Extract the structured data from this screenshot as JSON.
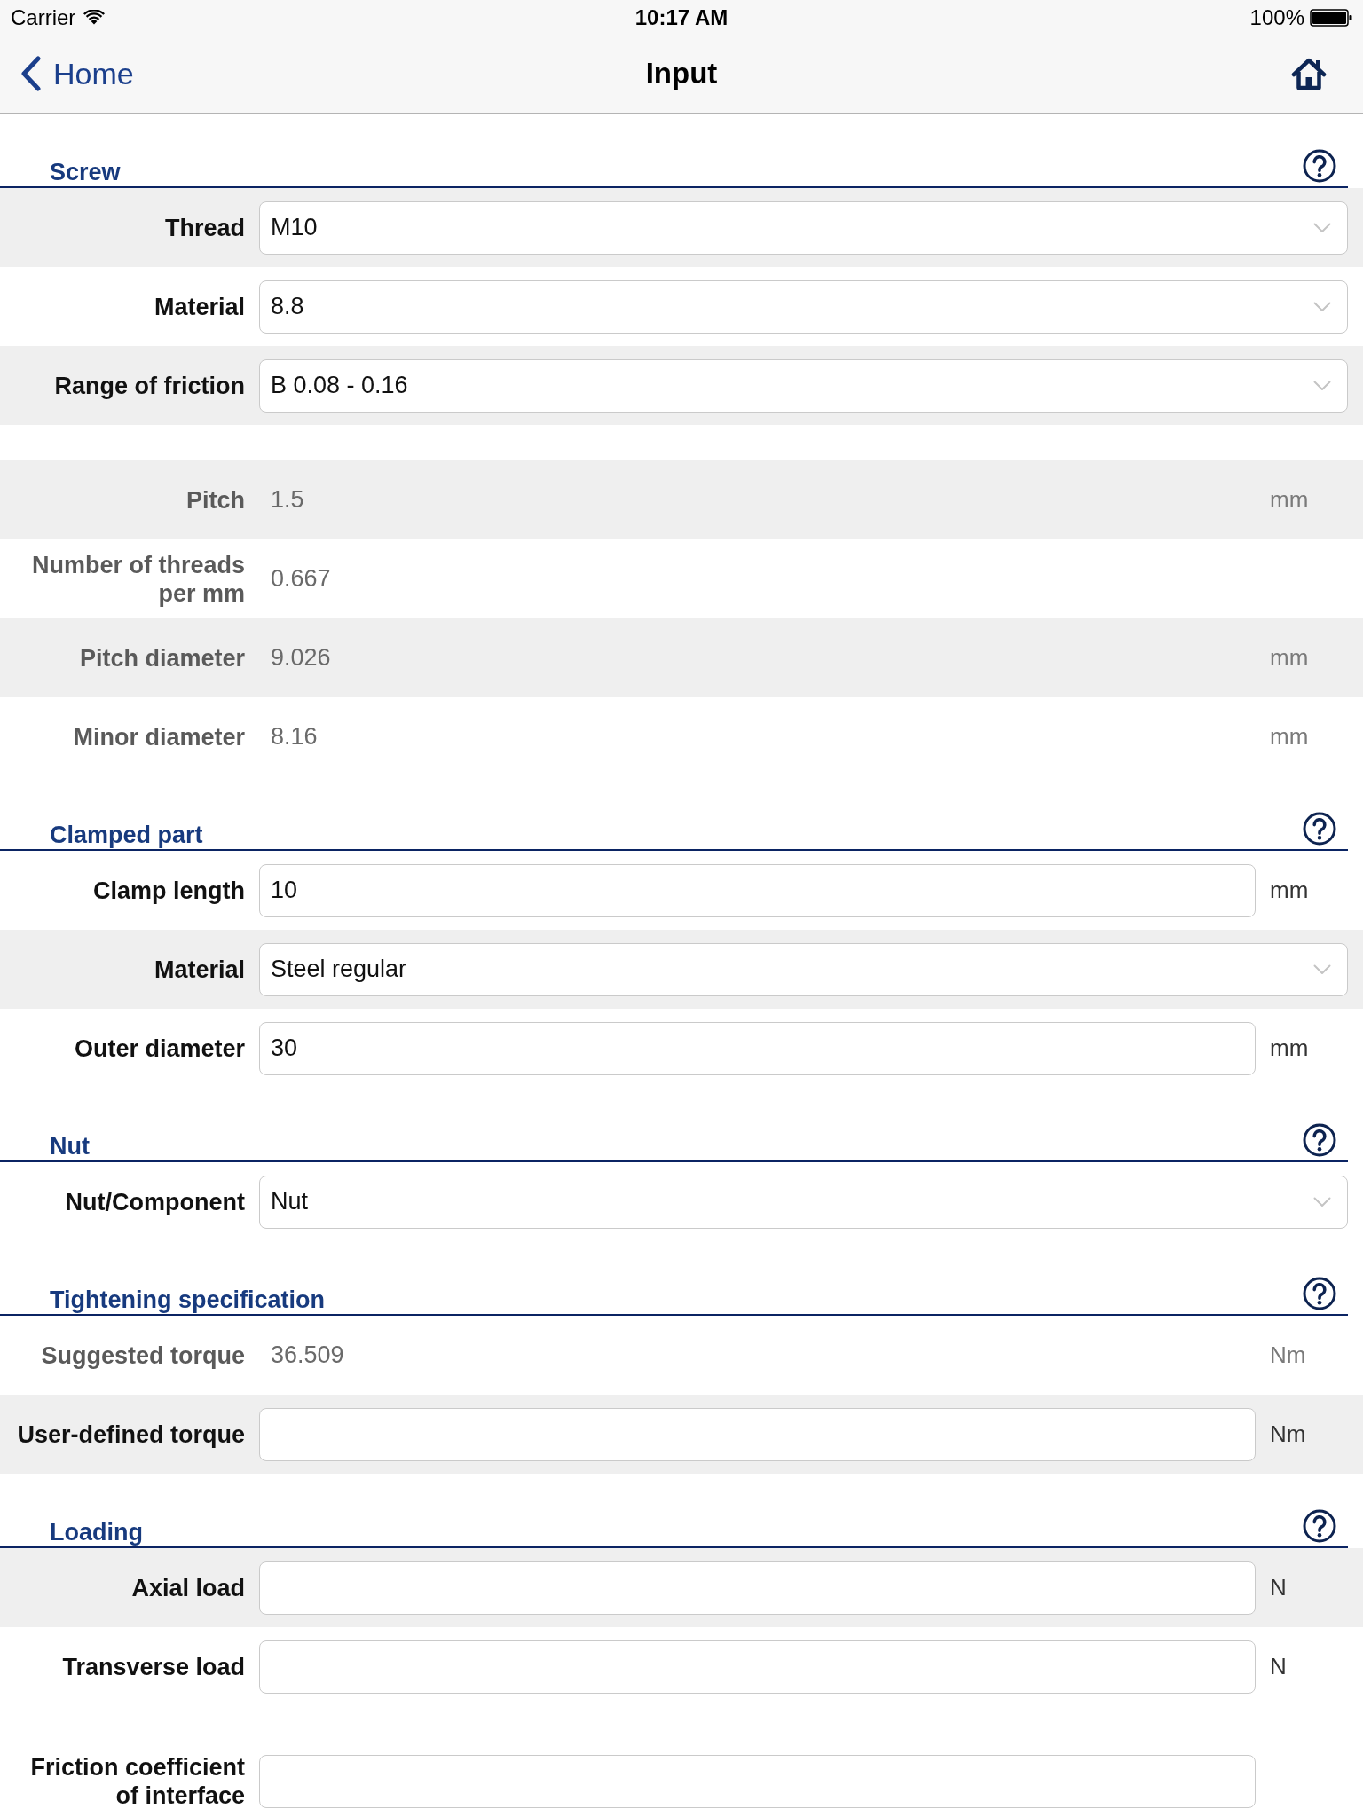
{
  "status_bar": {
    "carrier": "Carrier",
    "time": "10:17 AM",
    "battery": "100%"
  },
  "nav_bar": {
    "back": "Home",
    "title": "Input"
  },
  "sections": [
    {
      "title": "Screw",
      "groups": [
        {
          "rows": [
            {
              "kind": "select",
              "label": "Thread",
              "value": "M10",
              "shaded": true
            },
            {
              "kind": "select",
              "label": "Material",
              "value": "8.8",
              "shaded": false
            },
            {
              "kind": "select",
              "label": "Range of friction",
              "value": "B 0.08 - 0.16",
              "shaded": true
            }
          ]
        },
        {
          "rows": [
            {
              "kind": "computed",
              "label": "Pitch",
              "value": "1.5",
              "unit": "mm",
              "shaded": true
            },
            {
              "kind": "computed",
              "label": "Number of threads per mm",
              "value": "0.667",
              "shaded": false
            },
            {
              "kind": "computed",
              "label": "Pitch diameter",
              "value": "9.026",
              "unit": "mm",
              "shaded": true
            },
            {
              "kind": "computed",
              "label": "Minor diameter",
              "value": "8.16",
              "unit": "mm",
              "shaded": false
            }
          ]
        }
      ]
    },
    {
      "title": "Clamped part",
      "groups": [
        {
          "rows": [
            {
              "kind": "input",
              "label": "Clamp length",
              "value": "10",
              "unit": "mm",
              "shaded": false
            },
            {
              "kind": "select",
              "label": "Material",
              "value": "Steel regular",
              "shaded": true
            },
            {
              "kind": "input",
              "label": "Outer diameter",
              "value": "30",
              "unit": "mm",
              "shaded": false
            }
          ]
        }
      ]
    },
    {
      "title": "Nut",
      "groups": [
        {
          "rows": [
            {
              "kind": "select",
              "label": "Nut/Component",
              "value": "Nut",
              "shaded": false
            }
          ]
        }
      ]
    },
    {
      "title": "Tightening specification",
      "groups": [
        {
          "rows": [
            {
              "kind": "computed",
              "label": "Suggested torque",
              "value": "36.509",
              "unit": "Nm",
              "shaded": false
            },
            {
              "kind": "input",
              "label": "User-defined torque",
              "unit": "Nm",
              "shaded": true
            }
          ]
        }
      ]
    },
    {
      "title": "Loading",
      "groups": [
        {
          "rows": [
            {
              "kind": "input",
              "label": "Axial load",
              "unit": "N",
              "shaded": true
            },
            {
              "kind": "input",
              "label": "Transverse load",
              "unit": "N",
              "shaded": false
            }
          ]
        },
        {
          "rows": [
            {
              "kind": "input",
              "label": "Friction coefficient of interface",
              "shaded": false
            }
          ]
        }
      ]
    }
  ]
}
